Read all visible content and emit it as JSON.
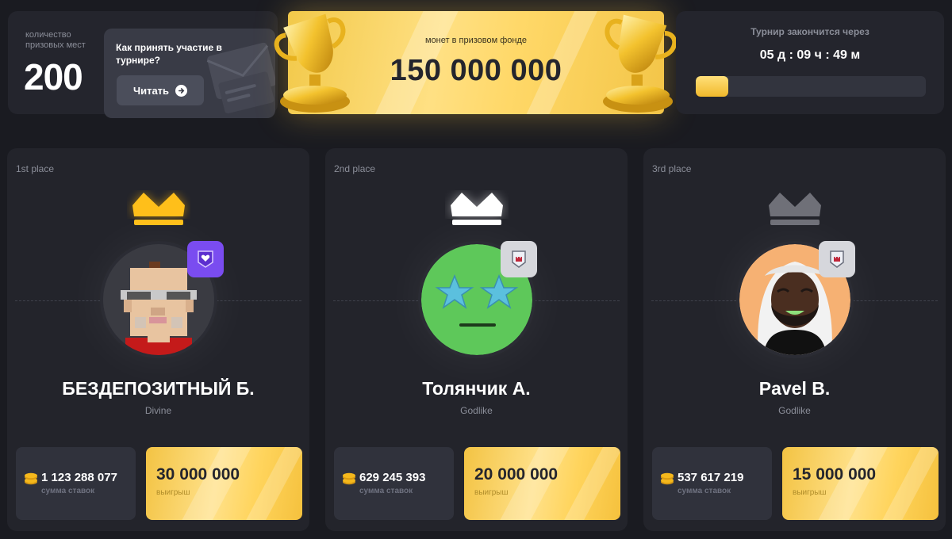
{
  "prize_places": {
    "label": "количество призовых мест",
    "value": "200"
  },
  "how_to": {
    "text": "Как принять участие в турнире?",
    "button_label": "Читать"
  },
  "prize_fund": {
    "label": "монет в призовом фонде",
    "value": "150 000 000"
  },
  "timer": {
    "label": "Турнир закончится через",
    "value": "05 д : 09 ч : 49 м",
    "progress": 0.14
  },
  "colors": {
    "gold": "#f5c542",
    "background": "#1a1b21",
    "card": "#23242b"
  },
  "podium": [
    {
      "place_label": "1st place",
      "crown_color": "gold",
      "avatar": "pixel-glasses-man-avatar",
      "badge": "divine-heart-badge-icon",
      "name": "БЕЗДЕПОЗИТНЫЙ Б.",
      "rank": "Divine",
      "bets_value": "1 123 288 077",
      "bets_label": "сумма ставок",
      "win_value": "30 000 000",
      "win_label": "выигрыш"
    },
    {
      "place_label": "2nd place",
      "crown_color": "white",
      "avatar": "star-eyes-face-avatar",
      "badge": "godlike-castle-badge-icon",
      "name": "Толянчик А.",
      "rank": "Godlike",
      "bets_value": "629 245 393",
      "bets_label": "сумма ставок",
      "win_value": "20 000 000",
      "win_label": "выигрыш"
    },
    {
      "place_label": "3rd place",
      "crown_color": "gray",
      "avatar": "bearded-man-avatar",
      "badge": "godlike-castle-badge-icon",
      "name": "Pavel B.",
      "rank": "Godlike",
      "bets_value": "537 617 219",
      "bets_label": "сумма ставок",
      "win_value": "15 000 000",
      "win_label": "выигрыш"
    }
  ]
}
